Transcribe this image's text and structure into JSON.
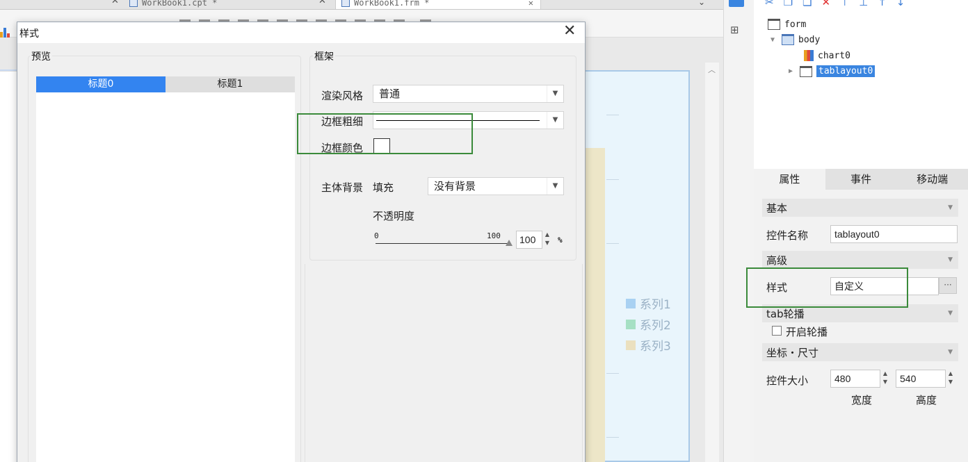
{
  "file_tabs": [
    {
      "label": "WorkBook1.cpt *"
    },
    {
      "label": "WorkBook1.frm *"
    }
  ],
  "chart_legend": [
    "系列1",
    "系列2",
    "系列3"
  ],
  "legend_colors": [
    "#a9d1f2",
    "#a6e0c4",
    "#ebe0bf"
  ],
  "dialog": {
    "title": "样式",
    "preview": {
      "group_title": "预览",
      "tabs": [
        "标题0",
        "标题1"
      ]
    },
    "frame": {
      "group_title": "框架",
      "render_style_label": "渲染风格",
      "render_style_value": "普通",
      "border_width_label": "边框粗细",
      "border_color_label": "边框颜色",
      "background_label": "主体背景",
      "fill_label": "填充",
      "fill_value": "没有背景",
      "opacity_label": "不透明度",
      "opacity_min": "0",
      "opacity_max": "100",
      "opacity_value": "100",
      "opacity_unit": "%"
    }
  },
  "tree": {
    "nodes": [
      {
        "label": "form"
      },
      {
        "label": "body"
      },
      {
        "label": "chart0"
      },
      {
        "label": "tablayout0"
      }
    ]
  },
  "props": {
    "tabs": [
      "属性",
      "事件",
      "移动端"
    ],
    "section_basic": "基本",
    "name_label": "控件名称",
    "name_value": "tablayout0",
    "section_advanced": "高级",
    "style_label": "样式",
    "style_value": "自定义",
    "section_tab_carousel": "tab轮播",
    "carousel_label": "开启轮播",
    "section_coords": "坐标・尺寸",
    "size_label": "控件大小",
    "width_value": "480",
    "height_value": "540",
    "width_caption": "宽度",
    "height_caption": "高度"
  },
  "colors": {
    "accent": "#3384f0",
    "highlight_box": "#3a8a3a"
  }
}
